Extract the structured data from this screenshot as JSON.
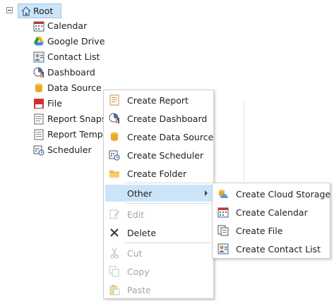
{
  "tree": {
    "root_label": "Root",
    "items": [
      {
        "label": "Calendar",
        "icon": "calendar-icon"
      },
      {
        "label": "Google Drive",
        "icon": "google-drive-icon"
      },
      {
        "label": "Contact List",
        "icon": "contact-list-icon"
      },
      {
        "label": "Dashboard",
        "icon": "dashboard-icon"
      },
      {
        "label": "Data Source",
        "icon": "database-icon"
      },
      {
        "label": "File",
        "icon": "pdf-file-icon"
      },
      {
        "label": "Report Snapsho",
        "icon": "report-snapshot-icon"
      },
      {
        "label": "Report Templat",
        "icon": "report-template-icon"
      },
      {
        "label": "Scheduler",
        "icon": "scheduler-icon"
      }
    ]
  },
  "context_menu": {
    "items": [
      {
        "label": "Create Report",
        "icon": "report-icon"
      },
      {
        "label": "Create Dashboard",
        "icon": "dashboard-icon"
      },
      {
        "label": "Create Data Source",
        "icon": "database-icon"
      },
      {
        "label": "Create Scheduler",
        "icon": "scheduler-icon"
      },
      {
        "label": "Create Folder",
        "icon": "folder-icon"
      },
      {
        "label": "Other",
        "icon": ""
      },
      {
        "label": "Edit",
        "icon": "edit-icon"
      },
      {
        "label": "Delete",
        "icon": "delete-icon"
      },
      {
        "label": "Cut",
        "icon": "cut-icon"
      },
      {
        "label": "Copy",
        "icon": "copy-icon"
      },
      {
        "label": "Paste",
        "icon": "paste-icon"
      }
    ]
  },
  "submenu": {
    "items": [
      {
        "label": "Create Cloud Storage",
        "icon": "cloud-storage-icon"
      },
      {
        "label": "Create Calendar",
        "icon": "calendar-icon"
      },
      {
        "label": "Create File",
        "icon": "file-icon"
      },
      {
        "label": "Create Contact List",
        "icon": "contact-list-icon"
      }
    ]
  },
  "colors": {
    "selection": "#cce4f7",
    "selection_border": "#99c9ef",
    "disabled_text": "#a6a6a6",
    "separator": "#d9d9d9"
  }
}
